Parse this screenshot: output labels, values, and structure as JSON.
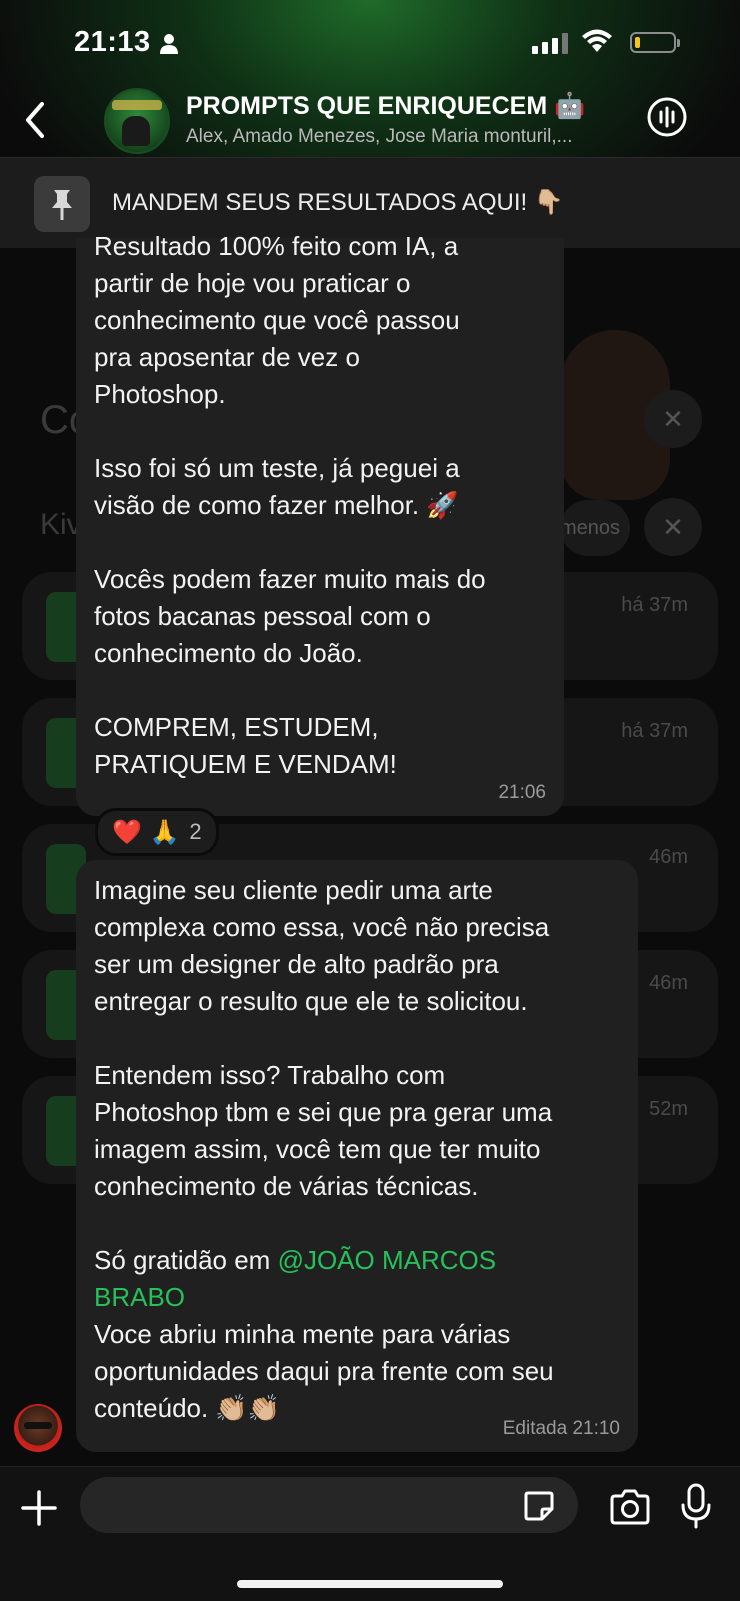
{
  "status": {
    "time": "21:13"
  },
  "header": {
    "title": "PROMPTS QUE ENRIQUECEM 🤖",
    "members": "Alex, Amado Menezes, Jose Maria monturil,..."
  },
  "pinned": {
    "text": "MANDEM SEUS RESULTADOS AQUI! 👇🏼"
  },
  "messages": [
    {
      "text": "Resultado 100% feito com IA, a\npartir de hoje vou praticar o\nconhecimento que você passou\npra aposentar de vez o\nPhotoshop.\n\nIsso foi só um teste, já peguei a\nvisão de como fazer melhor. 🚀\n\nVocês podem fazer muito mais do\nfotos bacanas pessoal com o\nconhecimento do João.\n\nCOMPREM, ESTUDEM,\nPRATIQUEM E VENDAM!",
      "time": "21:06",
      "reactions": {
        "emojis": "❤️ 🙏",
        "count": "2"
      }
    },
    {
      "text_before": "Imagine seu cliente pedir uma arte\ncomplexa como essa, você não precisa\nser um designer de alto padrão pra\nentregar o resulto que ele te solicitou.\n\nEntendem isso? Trabalho com\nPhotoshop tbm e sei que pra gerar uma\nimagem assim, você tem que ter muito\nconhecimento de várias técnicas.\n\nSó gratidão em ",
      "mention": "@JOÃO MARCOS\nBRABO",
      "text_after": "\nVoce abriu minha mente para várias\noportunidades daqui pra frente com seu\nconteúdo. 👏🏼👏🏼",
      "time": "Editada  21:10"
    }
  ],
  "background": {
    "letters_1": "Co",
    "letters_2": "Kiv",
    "chip": "menos",
    "times": [
      "há 37m",
      "há 37m",
      "46m",
      "46m",
      "52m"
    ]
  },
  "icons": [
    "person-icon",
    "back-icon",
    "phone-wave-icon",
    "pin-icon",
    "plus-icon",
    "sticker-icon",
    "camera-icon",
    "mic-icon"
  ],
  "colors": {
    "accent": "#25c15a",
    "bubble": "#202020",
    "background": "#0b0b0b"
  }
}
